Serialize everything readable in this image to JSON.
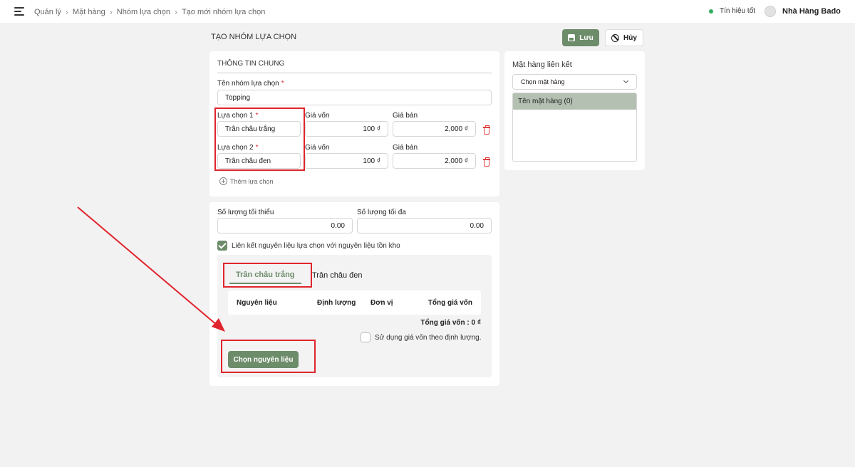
{
  "breadcrumb": [
    "Quản lý",
    "Mặt hàng",
    "Nhóm lựa chọn",
    "Tạo mới nhóm lựa chọn"
  ],
  "header": {
    "status_text": "Tín hiệu tốt",
    "status_color": "#2fae5a",
    "store_name": "Nhà Hàng Bado"
  },
  "page": {
    "title": "TẠO NHÓM LỰA CHỌN",
    "save_label": "Lưu",
    "cancel_label": "Hủy"
  },
  "general": {
    "section_title": "THÔNG TIN CHUNG",
    "group_name_label": "Tên nhóm lựa chọn",
    "group_name_value": "Topping",
    "options": [
      {
        "label": "Lựa chọn 1",
        "name": "Trân châu trắng",
        "cost_label": "Giá vốn",
        "cost": "100 ₫",
        "price_label": "Giá bán",
        "price": "2,000 ₫"
      },
      {
        "label": "Lựa chọn 2",
        "name": "Trân châu đen",
        "cost_label": "Giá vốn",
        "cost": "100 ₫",
        "price_label": "Giá bán",
        "price": "2,000 ₫"
      }
    ],
    "add_option_label": "Thêm lựa chọn"
  },
  "quantity": {
    "min_label": "Số lượng tối thiểu",
    "min_value": "0.00",
    "max_label": "Số lượng tối đa",
    "max_value": "0.00",
    "link_label": "Liên kết nguyên liệu lựa chọn với nguyên liệu tồn kho",
    "link_checked": true
  },
  "ingredients": {
    "tabs": [
      "Trân châu trắng",
      "Trân châu đen"
    ],
    "active_tab": 0,
    "columns": [
      "Nguyên liệu",
      "Định lượng",
      "Đơn vị",
      "Tổng giá vốn"
    ],
    "total_text": "Tổng giá vốn : 0 ₫",
    "use_cost_label": "Sử dụng giá vốn theo định lượng.",
    "use_cost_checked": false,
    "pick_button": "Chọn nguyên liệu"
  },
  "linked": {
    "title": "Mặt hàng liên kết",
    "select_placeholder": "Chọn mặt hàng",
    "list_header": "Tên mặt hàng (0)"
  },
  "colors": {
    "accent": "#6d8c6a",
    "highlight": "#e0242c",
    "required": "#d33",
    "danger": "#e2413f"
  }
}
